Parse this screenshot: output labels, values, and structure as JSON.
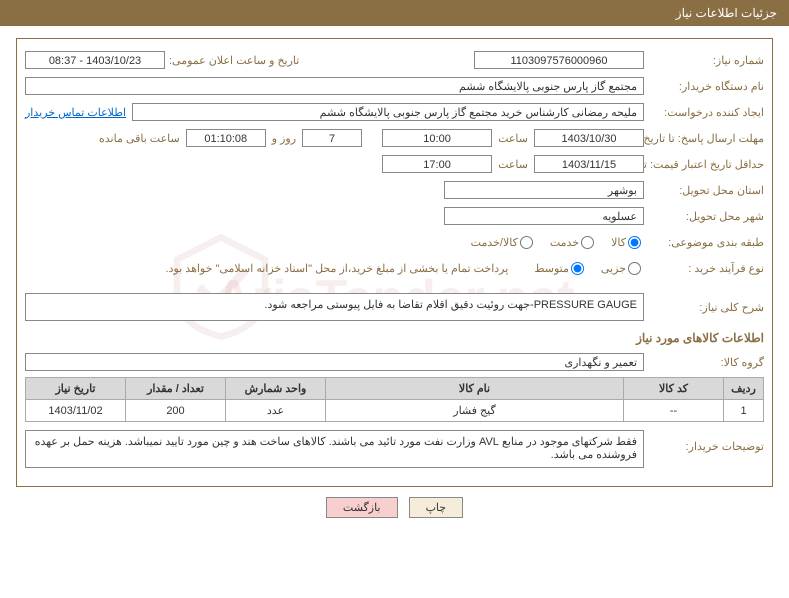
{
  "header": {
    "title": "جزئیات اطلاعات نیاز"
  },
  "watermark": "AriaTender.net",
  "fields": {
    "need_no_label": "شماره نیاز:",
    "need_no": "1103097576000960",
    "announce_label": "تاریخ و ساعت اعلان عمومی:",
    "announce": "1403/10/23 - 08:37",
    "buyer_org_label": "نام دستگاه خریدار:",
    "buyer_org": "مجتمع گاز پارس جنوبی پالایشگاه ششم",
    "requester_label": "ایجاد کننده درخواست:",
    "requester": "ملیحه رمضانی کارشناس خرید مجتمع گاز پارس جنوبی پالایشگاه ششم",
    "contact_link": "اطلاعات تماس خریدار",
    "deadline_label": "مهلت ارسال پاسخ: تا تاریخ:",
    "deadline_date": "1403/10/30",
    "time_label": "ساعت",
    "deadline_time": "10:00",
    "days_value": "7",
    "days_and": "روز و",
    "countdown": "01:10:08",
    "remaining_label": "ساعت باقی مانده",
    "validity_label": "حداقل تاریخ اعتبار قیمت: تا تاریخ:",
    "validity_date": "1403/11/15",
    "validity_time": "17:00",
    "delivery_province_label": "استان محل تحویل:",
    "delivery_province": "بوشهر",
    "delivery_city_label": "شهر محل تحویل:",
    "delivery_city": "عسلویه",
    "category_label": "طبقه بندی موضوعی:",
    "cat_goods": "کالا",
    "cat_service": "خدمت",
    "cat_both": "کالا/خدمت",
    "process_label": "نوع فرآیند خرید :",
    "proc_small": "جزیی",
    "proc_medium": "متوسط",
    "process_note": "پرداخت تمام یا بخشی از مبلغ خرید،از محل \"اسناد خزانه اسلامی\" خواهد بود.",
    "desc_label": "شرح کلی نیاز:",
    "desc": "PRESSURE GAUGE-جهت روئیت دقیق اقلام تقاضا به فایل پیوستی مراجعه شود.",
    "goods_section": "اطلاعات کالاهای مورد نیاز",
    "group_label": "گروه کالا:",
    "group": "تعمیر و نگهداری",
    "buyer_notes_label": "توضیحات خریدار:",
    "buyer_notes": "فقط شرکتهای موجود در منابع AVL وزارت نفت مورد تائید می باشند. کالاهای ساخت هند و چین مورد تایید نمیباشد. هزینه حمل بر عهده فروشنده می باشد."
  },
  "table": {
    "headers": {
      "row": "ردیف",
      "code": "کد کالا",
      "name": "نام کالا",
      "unit": "واحد شمارش",
      "qty": "تعداد / مقدار",
      "date": "تاریخ نیاز"
    },
    "rows": [
      {
        "row": "1",
        "code": "--",
        "name": "گیج فشار",
        "unit": "عدد",
        "qty": "200",
        "date": "1403/11/02"
      }
    ]
  },
  "buttons": {
    "print": "چاپ",
    "back": "بازگشت"
  }
}
